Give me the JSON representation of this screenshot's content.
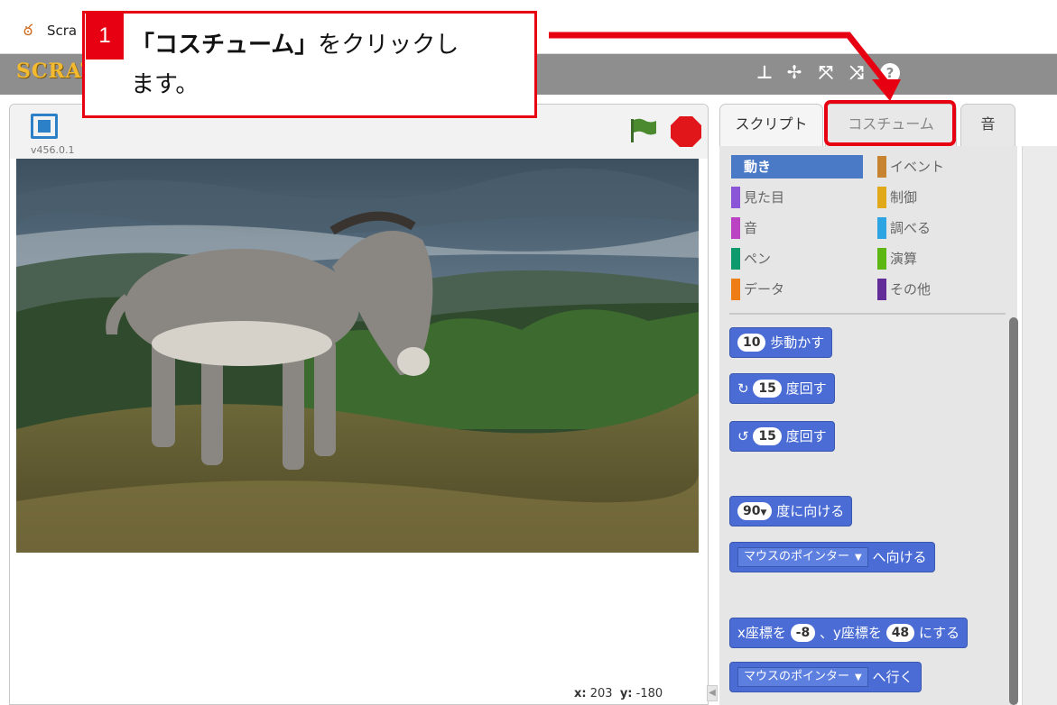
{
  "window": {
    "title": "Scra"
  },
  "stage": {
    "version": "v456.0.1",
    "coords_x_label": "x:",
    "coords_x": "203",
    "coords_y_label": "y:",
    "coords_y": "-180"
  },
  "tabs": {
    "scripts": "スクリプト",
    "costumes": "コスチューム",
    "sounds": "音"
  },
  "categories": [
    {
      "label": "動き",
      "color": "#4a6cd4"
    },
    {
      "label": "イベント",
      "color": "#c88330"
    },
    {
      "label": "見た目",
      "color": "#8a55d7"
    },
    {
      "label": "制御",
      "color": "#e1a91a"
    },
    {
      "label": "音",
      "color": "#bb42c3"
    },
    {
      "label": "調べる",
      "color": "#2ca5e2"
    },
    {
      "label": "ペン",
      "color": "#0e9a6c"
    },
    {
      "label": "演算",
      "color": "#5cb712"
    },
    {
      "label": "データ",
      "color": "#ee7d16"
    },
    {
      "label": "その他",
      "color": "#632d99"
    }
  ],
  "blocks": {
    "move": {
      "num": "10",
      "text": "歩動かす"
    },
    "turn_right": {
      "num": "15",
      "text": "度回す"
    },
    "turn_left": {
      "num": "15",
      "text": "度回す"
    },
    "point_dir": {
      "num": "90",
      "text": "度に向ける"
    },
    "point_towards": {
      "dropdown": "マウスのポインター",
      "text": "へ向ける"
    },
    "goto_xy": {
      "prefix": "x座標を",
      "x": "-8",
      "mid": "、y座標を",
      "y": "48",
      "suffix": "にする"
    },
    "goto": {
      "dropdown": "マウスのポインター",
      "text": "へ行く"
    }
  },
  "callout": {
    "step": "1",
    "text_bold": "「コスチューム」",
    "text_rest": "をクリックし",
    "text_line2": "ます。"
  },
  "colors": {
    "accent_red": "#e60012",
    "motion_blue": "#4a6cd4",
    "menubar_gray": "#8e8e8e"
  }
}
